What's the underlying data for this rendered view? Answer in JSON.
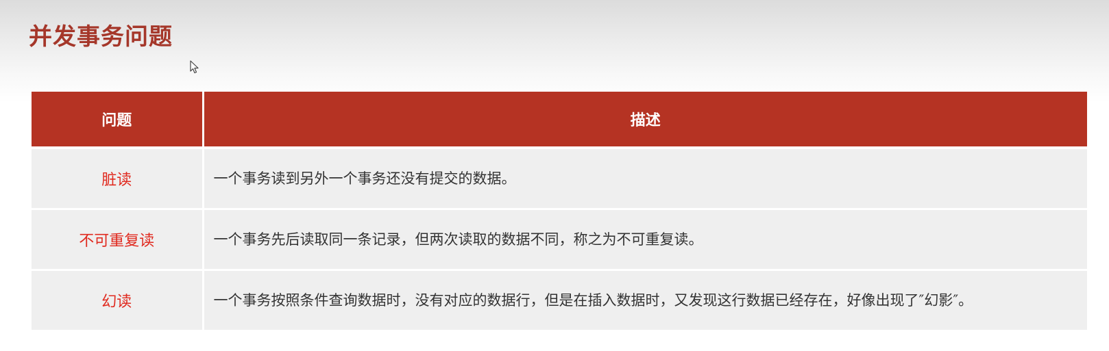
{
  "slide": {
    "title": "并发事务问题"
  },
  "table": {
    "headers": {
      "problem": "问题",
      "description": "描述"
    },
    "rows": [
      {
        "problem": "脏读",
        "description": "一个事务读到另外一个事务还没有提交的数据。"
      },
      {
        "problem": "不可重复读",
        "description": "一个事务先后读取同一条记录，但两次读取的数据不同，称之为不可重复读。"
      },
      {
        "problem": "幻读",
        "description": "一个事务按照条件查询数据时，没有对应的数据行，但是在插入数据时，又发现这行数据已经存在，好像出现了″幻影″。"
      }
    ]
  },
  "colors": {
    "title": "#a5372a",
    "header_bg": "#b53323",
    "problem_text": "#e02a1f",
    "row_bg": "#efefef"
  },
  "icons": {
    "cursor": "mouse-pointer-icon"
  }
}
